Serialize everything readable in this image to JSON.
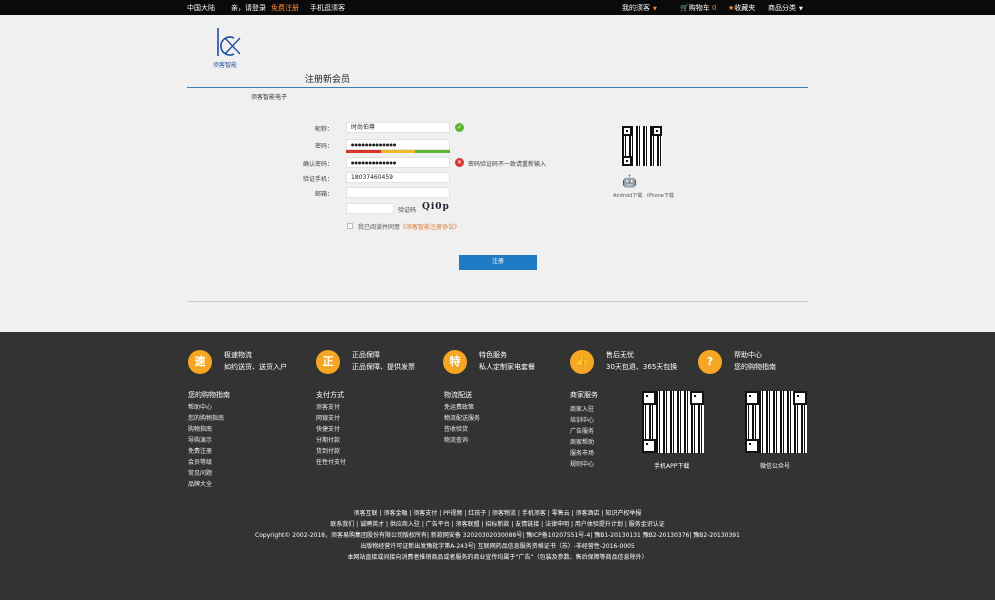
{
  "topbar": {
    "region": "中国大陆",
    "greeting": "亲，请登录",
    "register": "免费注册",
    "mobile": "手机逛须客",
    "my_account": "我的须客",
    "cart": "购物车",
    "cart_count": "0",
    "favorites": "收藏夹",
    "categories": "商品分类"
  },
  "header": {
    "logo_text": "须客智能",
    "title": "注册新会员",
    "company": "须客智能电子"
  },
  "form": {
    "nickname_label": "昵称：",
    "nickname_value": "时尚伯尊",
    "password_label": "密码：",
    "password_value": "●●●●●●●●●●●●●",
    "confirm_label": "确认密码：",
    "confirm_value": "●●●●●●●●●●●●●",
    "confirm_error": "密码验证码不一致请重新输入",
    "phone_label": "验证手机：",
    "phone_value": "18037460459",
    "email_label": "邮箱：",
    "email_value": "",
    "captcha_label": "验证码",
    "captcha_value": "Qi0p",
    "agree_prefix": "我已阅读并同意",
    "agree_link": "《须客智能注册协议》",
    "submit": "注册",
    "strength_colors": [
      "#d9342b",
      "#f0b92c",
      "#5cb531"
    ]
  },
  "apps": {
    "android": "Android下载",
    "iphone": "iPhone下载"
  },
  "services": [
    {
      "icon": "速",
      "title": "极速物流",
      "sub": "如约送货、送货入户"
    },
    {
      "icon": "正",
      "title": "正品保障",
      "sub": "正品保障、提供发票"
    },
    {
      "icon": "特",
      "title": "特色服务",
      "sub": "私人定制家电套餐"
    },
    {
      "icon": "👍",
      "title": "售后无忧",
      "sub": "30天包退、365天包换"
    },
    {
      "icon": "?",
      "title": "帮助中心",
      "sub": "您的购物指南"
    }
  ],
  "columns": [
    {
      "head": "您的购物指南",
      "items": [
        "帮助中心",
        "您的购物指南",
        "购物指南",
        "导购演示",
        "免费注册",
        "会员等级",
        "常见问题",
        "品牌大全"
      ]
    },
    {
      "head": "支付方式",
      "items": [
        "须客支付",
        "网银支付",
        "快捷支付",
        "分期付款",
        "货到付款",
        "任性付支付"
      ]
    },
    {
      "head": "物流配送",
      "items": [
        "免运费政策",
        "物流配送服务",
        "签收验货",
        "物流查询"
      ]
    },
    {
      "head": "商家服务",
      "items": [
        "商家入驻",
        "培训中心",
        "广告服务",
        "商家帮助",
        "服务市场",
        "规则中心"
      ]
    }
  ],
  "qr_captions": {
    "app": "手机APP下载",
    "wechat": "微信公众号"
  },
  "footer_lines": [
    "须客互联 | 须客金融 | 须客支付 | PP视频 | 红孩子 | 须客物流 | 手机须客 | 零售云 | 须客酒店 | 知识产权举报",
    "联系我们 | 诚聘英才 | 供应商入驻 | 广告平台 | 须客联盟 | 招标新款 | 友情链接 | 法律申明 | 用户体验提升计划 | 服务金识认证",
    "Copyright© 2002-2018，须客易购集团股份有限公司版权所有| 新款网安备 32020302030088号| 豫ICP备10207551号-4| 豫B1-20130131 豫B2-20130376| 豫B2-20130391",
    "出版物经营许可证新出发豫批字第A-243号| 互联网药品信息服务资格证书（苏）-非经营性-2016-0005",
    "本网站直接或间接向消费者推销商品或者服务的商业宣传均属于“广告”（包装及参数、售后保障等商品信息除外）"
  ]
}
